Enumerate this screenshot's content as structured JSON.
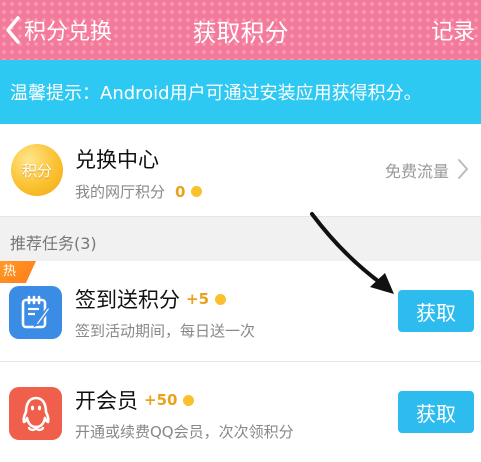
{
  "header": {
    "back_label": "积分兑换",
    "title": "获取积分",
    "record_label": "记录"
  },
  "tip": {
    "text": "温馨提示：Android用户可通过安装应用获得积分。"
  },
  "exchange": {
    "coin_label": "积分",
    "title": "兑换中心",
    "subtitle": "我的网厅积分",
    "points": "0",
    "free_flow": "免费流量"
  },
  "section": {
    "label": "推荐任务(3)"
  },
  "tasks": [
    {
      "badge": "热",
      "title": "签到送积分",
      "points": "+5",
      "desc": "签到活动期间，每日送一次",
      "button": "获取",
      "icon": "note-edit-icon",
      "icon_color": "#3a8ce5"
    },
    {
      "title": "开会员",
      "points": "+50",
      "desc": "开通或续费QQ会员，次次领积分",
      "button": "获取",
      "icon": "penguin-icon",
      "icon_color": "#f05f4c"
    }
  ],
  "colors": {
    "header_pink": "#f47a9c",
    "tip_blue": "#2ec9f3",
    "button_blue": "#2ebbee",
    "points_orange": "#e8a31b",
    "hot_orange": "#ff8a1f"
  }
}
